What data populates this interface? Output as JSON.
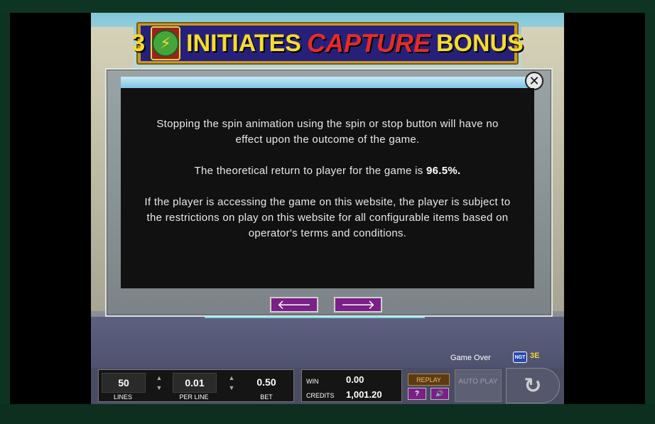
{
  "title": {
    "number": "3",
    "word1": "INITIATES",
    "word2": "CAPTURE",
    "word3": "BONUS",
    "badge_glyph": "⚡"
  },
  "dialog": {
    "paragraph1": "Stopping the spin animation using the spin or stop button will have no effect upon the outcome of the game.",
    "paragraph2_prefix": "The theoretical return to player for the game is ",
    "rtp": "96.5%.",
    "paragraph3": "If the player is accessing the game on this website, the player is subject to the restrictions on play on this website for all configurable items based on operator's terms and conditions.",
    "close_glyph": "✕",
    "prev_glyph": "🡐",
    "next_glyph": "🡒"
  },
  "status": {
    "game_over": "Game Over",
    "provider_logo": "NGT",
    "provider_logo2": "3E"
  },
  "hud": {
    "lines_value": "50",
    "lines_label": "LINES",
    "per_line_value": "0.01",
    "per_line_label": "PER LINE",
    "bet_value": "0.50",
    "bet_label": "BET",
    "win_label": "WIN",
    "win_value": "0.00",
    "credits_label": "CREDITS",
    "credits_value": "1,001.20",
    "replay_label": "REPLAY",
    "help_label": "?",
    "sound_glyph": "🔊",
    "auto_play_label": "AUTO PLAY",
    "spin_glyph": "↻",
    "arrow_up": "▲",
    "arrow_down": "▼"
  },
  "colors": {
    "banner_gold": "#c79a26",
    "banner_blue": "#27207a",
    "title_yellow": "#f6dc2a",
    "title_red": "#e62a2a",
    "nav_purple": "#7a2088",
    "frame_green": "#0b2a1c"
  }
}
